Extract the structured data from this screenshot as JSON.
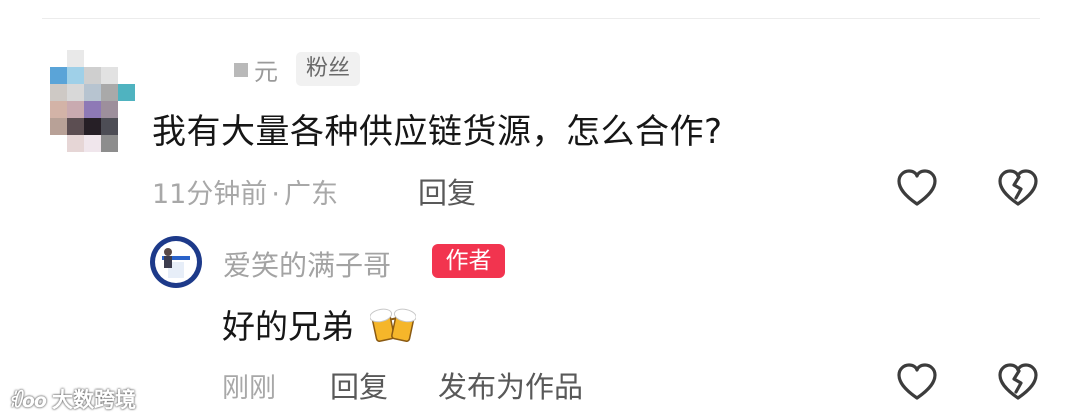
{
  "comment": {
    "username": "元",
    "badge": "粉丝",
    "text": "我有大量各种供应链货源，怎么合作?",
    "time": "11分钟前",
    "separator": "·",
    "location": "广东",
    "reply_label": "回复",
    "avatar_colors": [
      "#ffffff",
      "#e9e9e9",
      "#ffffff",
      "#ffffff",
      "#ffffff",
      "#5aa4d8",
      "#9fd0e8",
      "#cfcfcf",
      "#e2e2e2",
      "#ffffff",
      "#cec9c5",
      "#d8d8d8",
      "#b7c4d0",
      "#a9a9a9",
      "#4fb3c0",
      "#d3b3a7",
      "#c9aab0",
      "#8e79b6",
      "#9d8f9c",
      "#ffffff",
      "#b8a197",
      "#5c4e52",
      "#261f26",
      "#4d4d55",
      "#ffffff",
      "#ffffff",
      "#e6d6d6",
      "#f0e6ec",
      "#8d8d8d",
      "#ffffff"
    ]
  },
  "reply": {
    "username": "爱笑的满子哥",
    "badge": "作者",
    "text": "好的兄弟",
    "emoji": "beer-mugs",
    "time": "刚刚",
    "reply_label": "回复",
    "publish_label": "发布为作品"
  },
  "colors": {
    "author_badge": "#f2344f",
    "meta_gray": "#a8a8a8"
  },
  "watermark": {
    "logo": "ꂇoo",
    "text": "大数跨境"
  }
}
